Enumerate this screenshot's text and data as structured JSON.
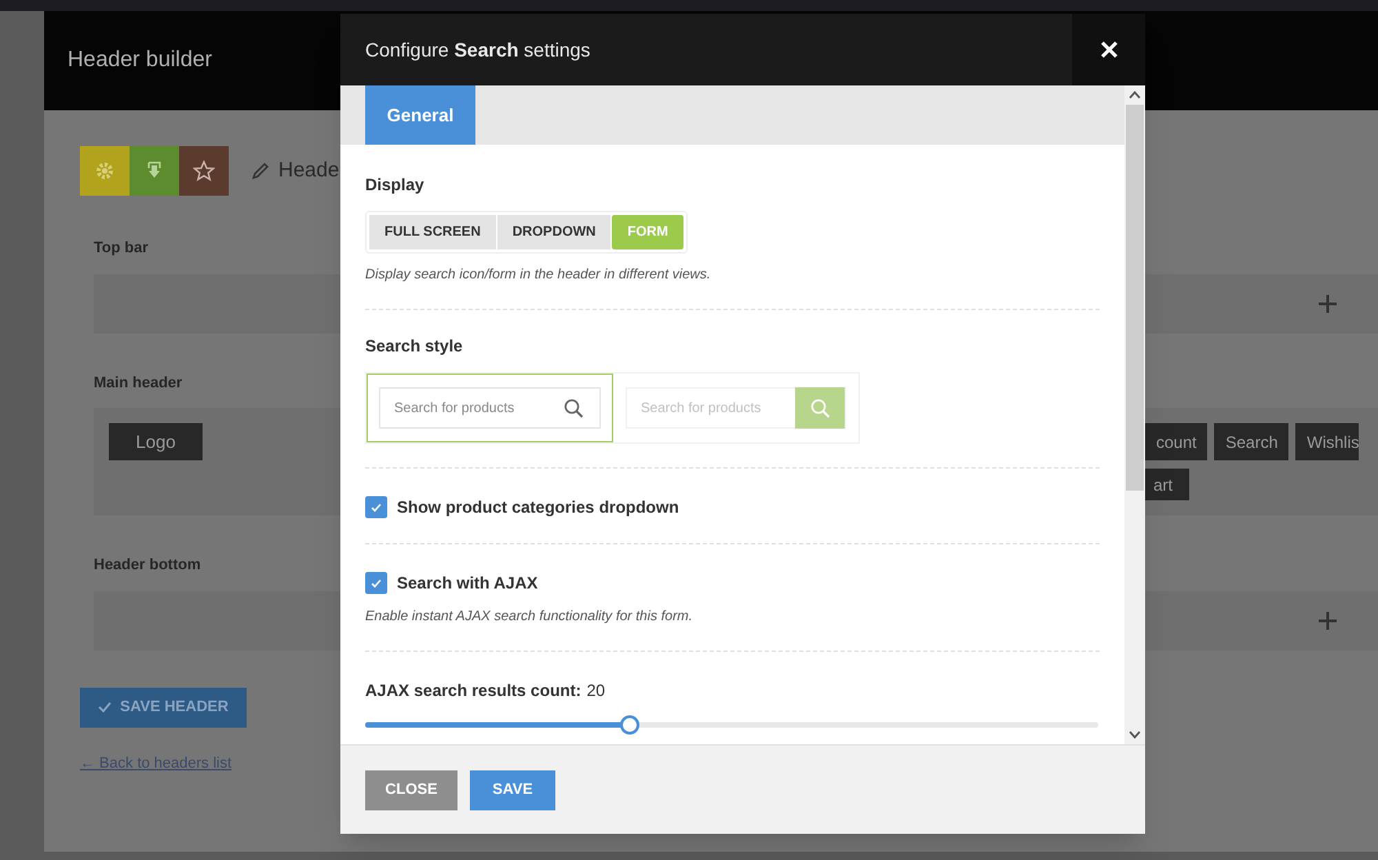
{
  "page": {
    "title": "Header builder",
    "toolbar": [
      {
        "kind": "gear",
        "color": "#b3a21c"
      },
      {
        "kind": "download",
        "color": "#5d8c2e"
      },
      {
        "kind": "star",
        "color": "#5b3b2e"
      }
    ],
    "edit_label": "Heade",
    "sections": [
      {
        "title": "Top bar"
      },
      {
        "title": "Main header",
        "left": [
          {
            "label": "Logo"
          }
        ],
        "right": [
          {
            "label": "count"
          },
          {
            "label": "Search"
          },
          {
            "label": "Wishlis"
          },
          {
            "label": "art"
          }
        ]
      },
      {
        "title": "Header bottom"
      }
    ],
    "save_button": "SAVE HEADER",
    "back_link": "← Back to headers list"
  },
  "dialog": {
    "title": "Configure **Search** settings",
    "tabs": [
      {
        "label": "General",
        "selected": true
      }
    ],
    "fields": [
      {
        "kind": "segmented",
        "label": "Display",
        "options": [
          {
            "label": "FULL SCREEN",
            "selected": false
          },
          {
            "label": "DROPDOWN",
            "selected": false
          },
          {
            "label": "FORM",
            "selected": true
          }
        ],
        "description": "Display search icon/form in the header in different views."
      },
      {
        "kind": "styles",
        "label": "Search style",
        "options": [
          {
            "placeholder": "Search for products",
            "selected": true
          },
          {
            "placeholder": "Search for products",
            "selected": false
          }
        ]
      },
      {
        "kind": "checkbox",
        "label": "Show product categories dropdown",
        "checked": true
      },
      {
        "kind": "checkbox",
        "label": "Search with AJAX",
        "checked": true,
        "description": "Enable instant AJAX search functionality for this form."
      },
      {
        "kind": "slider",
        "label": "AJAX search results count:",
        "reading": "20",
        "level": 0.36
      }
    ],
    "buttons": [
      {
        "label": "CLOSE",
        "kind": "secondary"
      },
      {
        "label": "SAVE",
        "kind": "primary"
      }
    ]
  }
}
